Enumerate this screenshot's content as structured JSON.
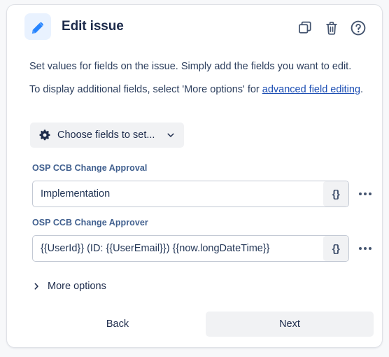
{
  "card": {
    "header": {
      "icon": "pencil-icon",
      "title": "Edit issue",
      "actions": [
        {
          "name": "copy-icon",
          "label": "Copy"
        },
        {
          "name": "trash-icon",
          "label": "Delete"
        },
        {
          "name": "help-icon",
          "label": "Help"
        }
      ]
    },
    "description": {
      "line1": "Set values for fields on the issue. Simply add the fields you want to edit.",
      "line2_prefix": "To display additional fields, select 'More options' for ",
      "line2_link": "advanced field editing",
      "line2_suffix": "."
    },
    "choose_fields": {
      "icon": "gear-icon",
      "label": "Choose fields to set...",
      "chevron": "chevron-down-icon"
    },
    "fields": [
      {
        "label": "OSP CCB Change Approval",
        "value": "Implementation",
        "placeholder": "",
        "brace_label": "{}",
        "more_label": "..."
      },
      {
        "label": "OSP CCB Change Approver",
        "value": "{{UserId}}  (ID: {{UserEmail}})  {{now.longDateTime}}",
        "placeholder": "",
        "brace_label": "{}",
        "more_label": "..."
      }
    ],
    "more_options": {
      "chevron": "chevron-right-icon",
      "label": "More options"
    },
    "footer": {
      "back_label": "Back",
      "next_label": "Next"
    }
  },
  "colors": {
    "accent": "#0c66e4",
    "title": "#1d2b4b",
    "link": "#1b4db3",
    "field_label": "#41608f",
    "button_bg": "#f1f2f4",
    "card_border": "#dfe1e6",
    "icon_bg": "#e9f2ff",
    "page_bg": "#f7f8fa"
  }
}
